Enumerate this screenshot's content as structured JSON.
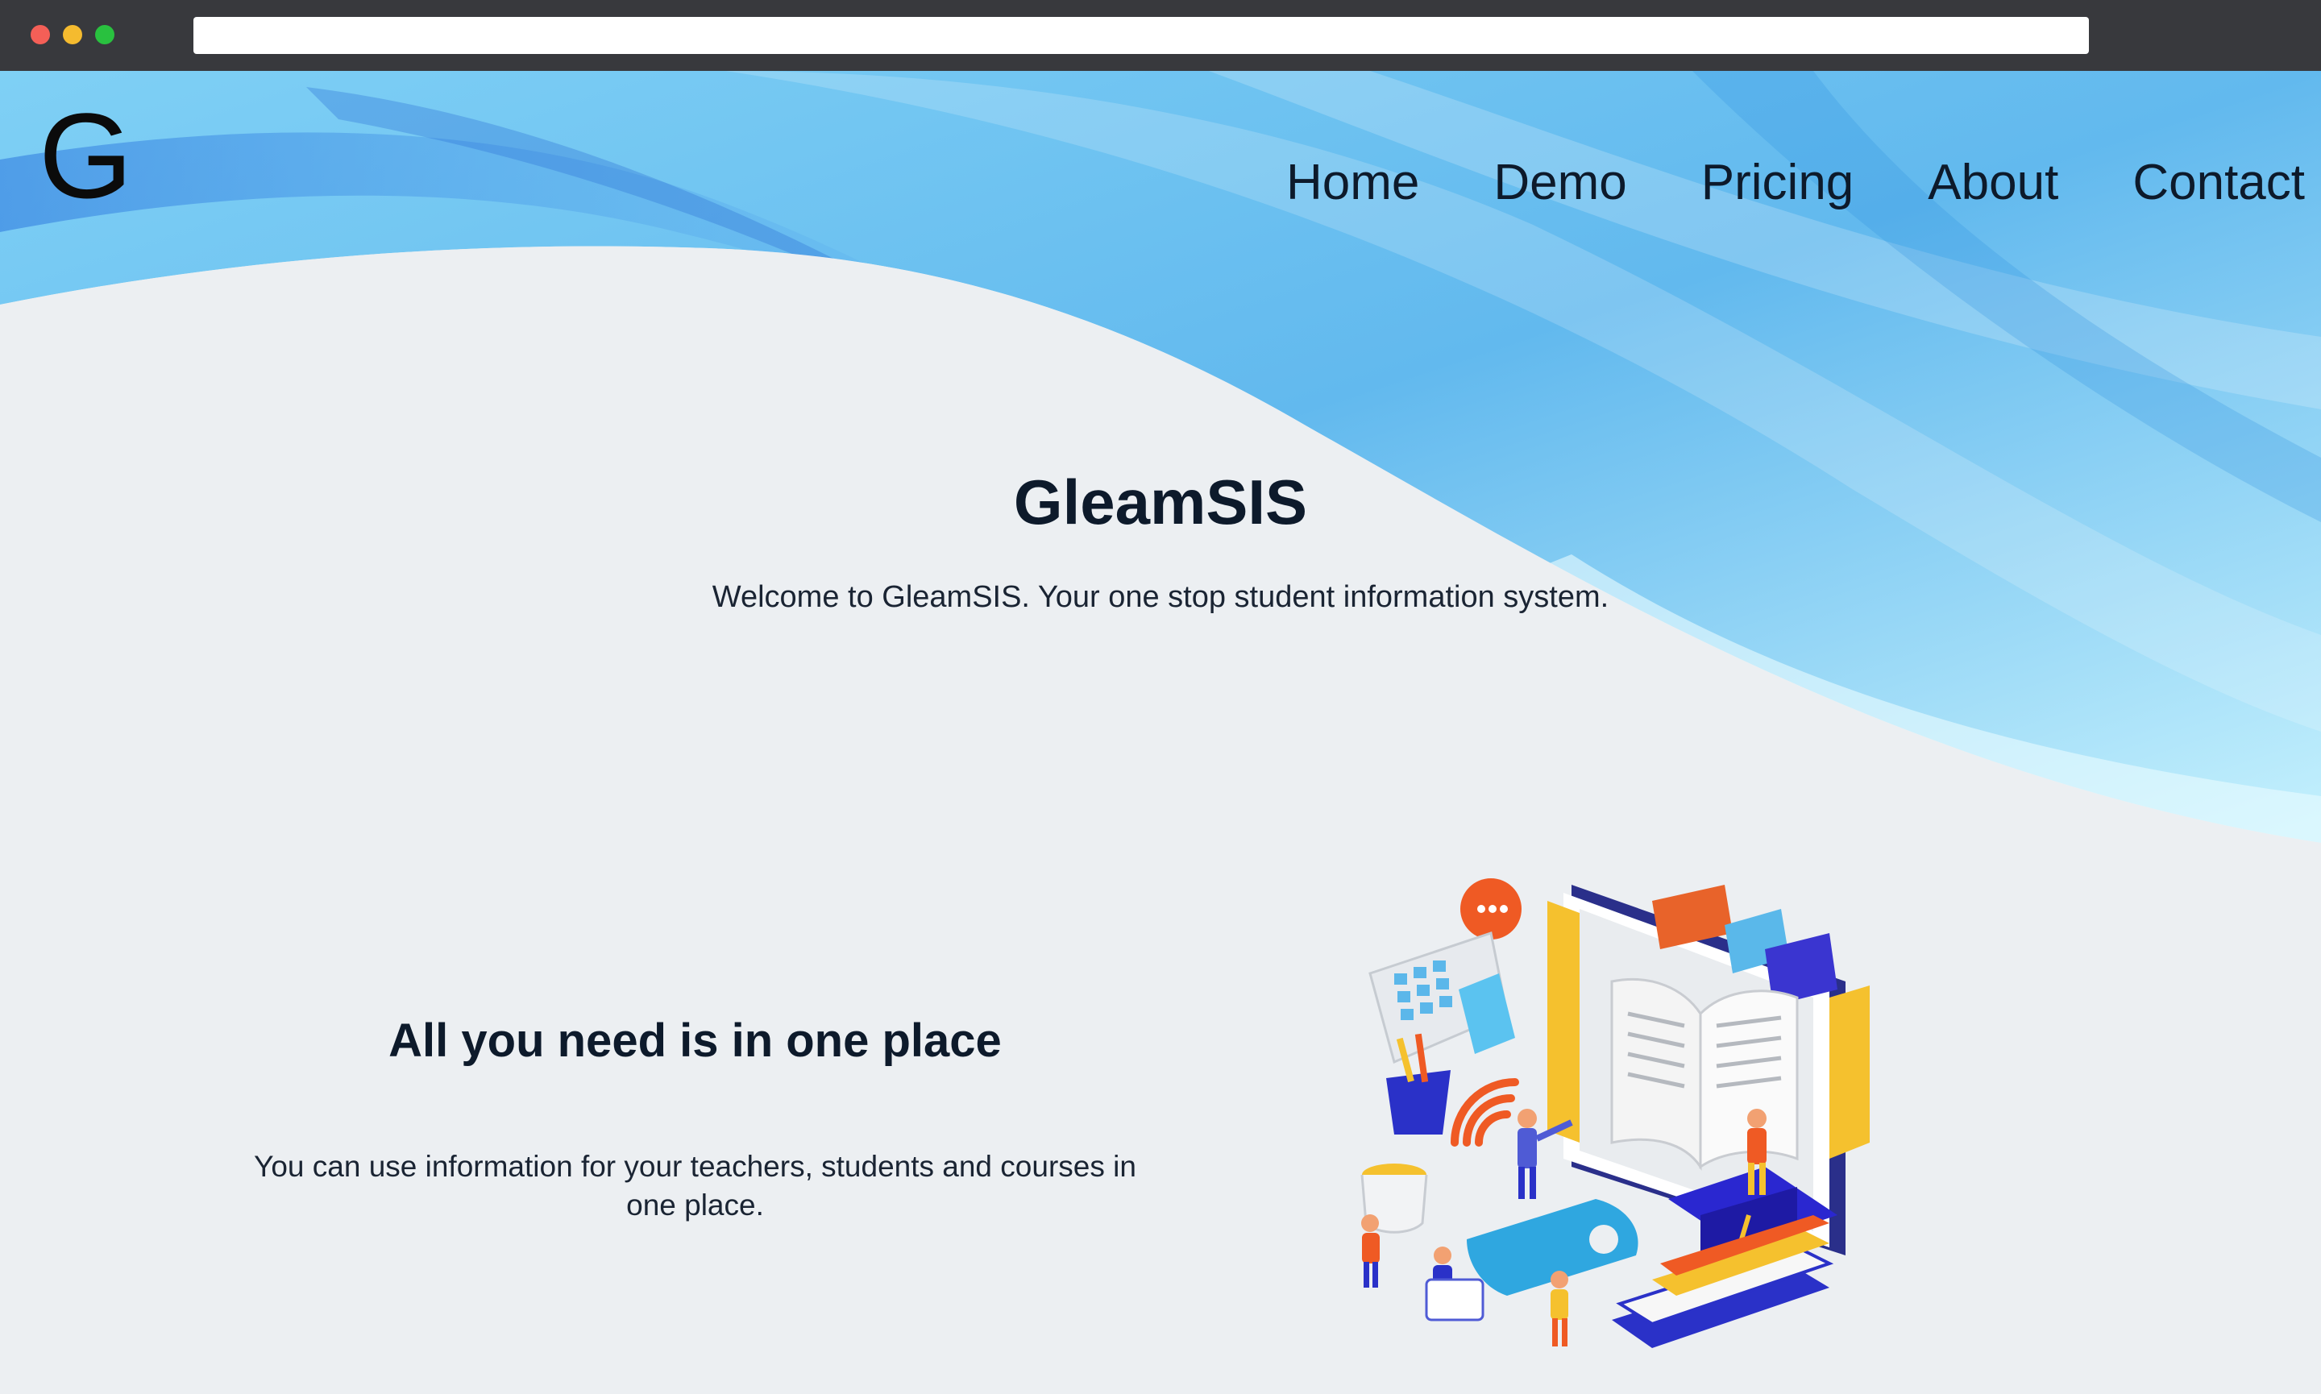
{
  "browser": {
    "url": ""
  },
  "brand": {
    "logo_letter": "G"
  },
  "nav": {
    "items": [
      "Home",
      "Demo",
      "Pricing",
      "About",
      "Contact"
    ]
  },
  "hero": {
    "title": "GleamSIS",
    "subtitle": "Welcome to GleamSIS. Your one stop student information system."
  },
  "feature": {
    "title": "All you need is in one place",
    "text": "You can use information for your teachers, students and courses in one place."
  },
  "colors": {
    "background": "#eceff2",
    "wave_light": "#bfe8fb",
    "wave_mid": "#7ccbf2",
    "wave_deep": "#3a8fe0",
    "heading": "#0d1a2b"
  },
  "icons": {
    "illustration": "education-isometric-illustration"
  }
}
